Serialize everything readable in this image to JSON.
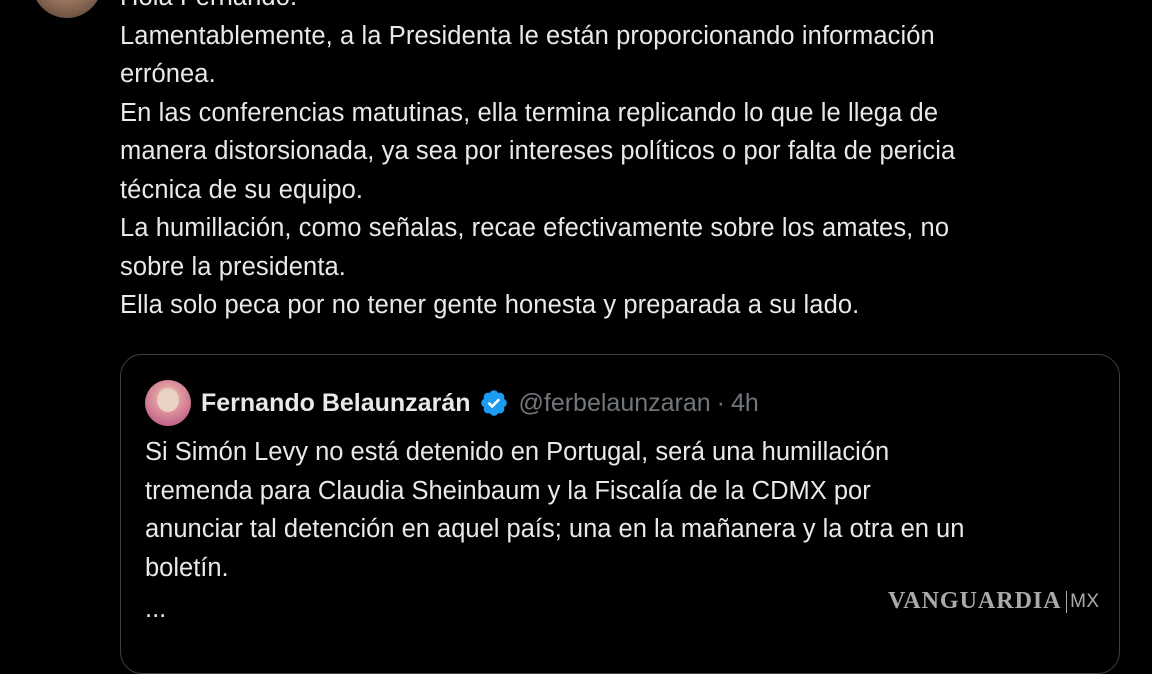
{
  "reply": {
    "lines": [
      "Hola Fernando.",
      "Lamentablemente, a la Presidenta le están proporcionando información\nerrónea.",
      "En las conferencias matutinas, ella termina replicando lo que le llega de\nmanera distorsionada, ya sea por intereses políticos o por falta de pericia\ntécnica de su equipo.",
      "La humillación, como señalas, recae efectivamente sobre los amates, no\nsobre la presidenta.",
      "Ella solo peca por no tener gente honesta y preparada a su lado."
    ]
  },
  "quote": {
    "author_name": "Fernando Belaunzarán",
    "handle": "@ferbelaunzaran",
    "separator": "·",
    "time": "4h",
    "text": "Si Simón Levy no está detenido en Portugal, será una humillación\ntremenda para Claudia Sheinbaum y la Fiscalía de la CDMX por\nanunciar tal detención en aquel país; una en la mañanera y la otra en un\nboletín.",
    "ellipsis": "..."
  },
  "watermark": {
    "brand": "VANGUARDIA",
    "suffix": "MX"
  },
  "colors": {
    "background": "#000000",
    "text": "#e7e9ea",
    "secondary_text": "#71767b",
    "verified_badge": "#1d9bf0",
    "card_border": "#3b4045"
  },
  "icons": {
    "verified": "verified-badge-icon"
  }
}
